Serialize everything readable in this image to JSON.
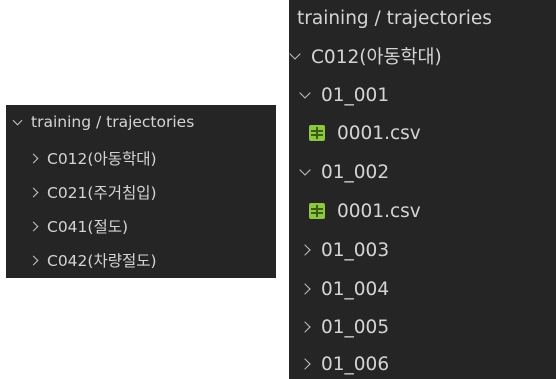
{
  "left_panel": {
    "root": {
      "label": "training / trajectories",
      "expanded": true
    },
    "items": [
      {
        "label": "C012(아동학대)",
        "expanded": false
      },
      {
        "label": "C021(주거침입)",
        "expanded": false
      },
      {
        "label": "C041(절도)",
        "expanded": false
      },
      {
        "label": "C042(차량절도)",
        "expanded": false
      }
    ]
  },
  "right_panel": {
    "root": {
      "label": "training / trajectories"
    },
    "folder": {
      "label": "C012(아동학대)",
      "expanded": true
    },
    "subfolders": [
      {
        "label": "01_001",
        "expanded": true,
        "file": "0001.csv"
      },
      {
        "label": "01_002",
        "expanded": true,
        "file": "0001.csv"
      },
      {
        "label": "01_003",
        "expanded": false
      },
      {
        "label": "01_004",
        "expanded": false
      },
      {
        "label": "01_005",
        "expanded": false
      },
      {
        "label": "01_006",
        "expanded": false
      }
    ],
    "file_icon": "csv-file-icon",
    "colors": {
      "background": "#252526",
      "text": "#cccccc",
      "csv_icon": "#8dc63f"
    }
  }
}
